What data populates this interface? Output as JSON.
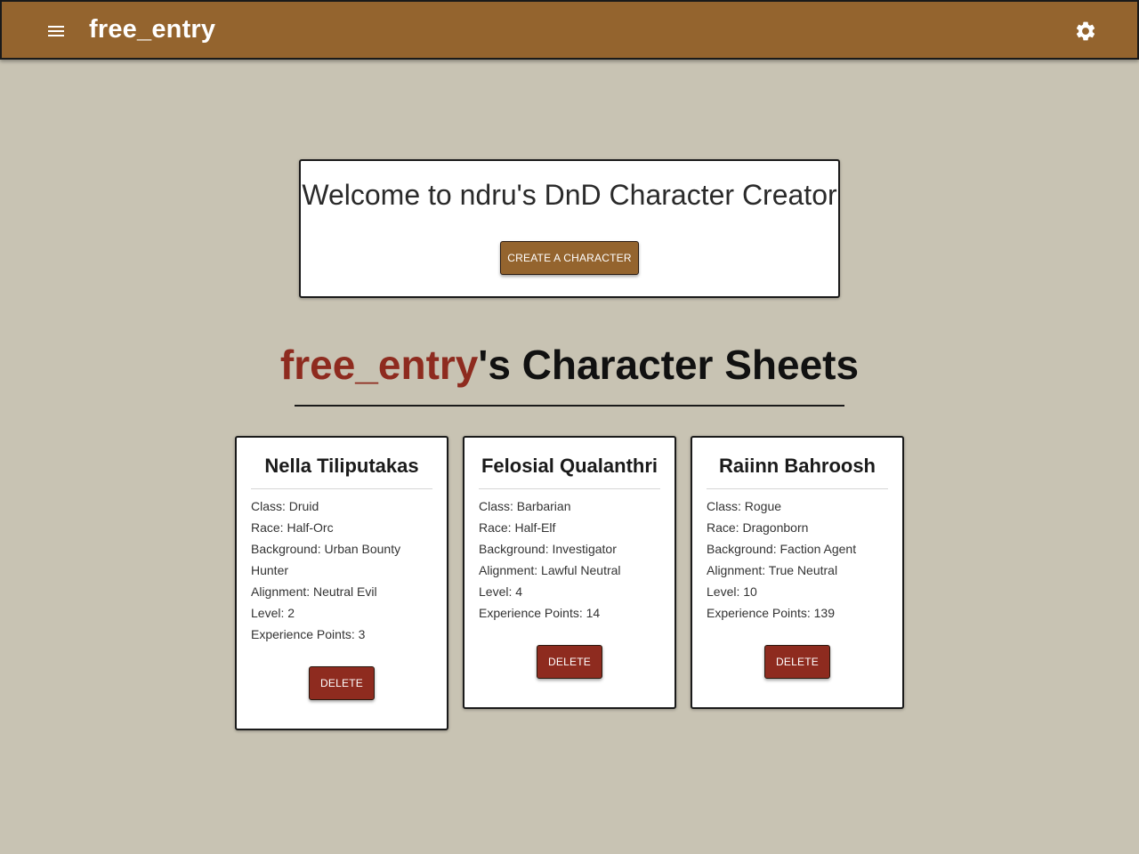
{
  "appbar": {
    "title": "free_entry",
    "menu_icon": "menu-icon",
    "settings_icon": "gear-icon",
    "color": "#94642e"
  },
  "welcome": {
    "title": "Welcome to ndru's DnD Character Creator",
    "create_label": "Create a Character"
  },
  "sheets": {
    "username": "free_entry",
    "heading_suffix": "'s Character Sheets"
  },
  "characters": [
    {
      "name": "Nella Tiliputakas",
      "class": "Class: Druid",
      "race": "Race: Half-Orc",
      "background": "Background: Urban Bounty Hunter",
      "alignment": "Alignment: Neutral Evil",
      "level": "Level: 2",
      "xp": "Experience Points: 3",
      "delete_label": "Delete"
    },
    {
      "name": "Felosial Qualanthri",
      "class": "Class: Barbarian",
      "race": "Race: Half-Elf",
      "background": "Background: Investigator",
      "alignment": "Alignment: Lawful Neutral",
      "level": "Level: 4",
      "xp": "Experience Points: 14",
      "delete_label": "Delete"
    },
    {
      "name": "Raiinn Bahroosh",
      "class": "Class: Rogue",
      "race": "Race: Dragonborn",
      "background": "Background: Faction Agent",
      "alignment": "Alignment: True Neutral",
      "level": "Level: 10",
      "xp": "Experience Points: 139",
      "delete_label": "Delete"
    }
  ],
  "colors": {
    "background": "#c8c3b3",
    "primary": "#94642e",
    "danger": "#8e2b1f",
    "username": "#8e2b1f"
  }
}
